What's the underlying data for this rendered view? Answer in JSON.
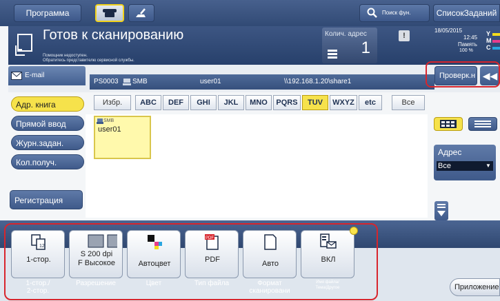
{
  "topbar": {
    "program_label": "Программа",
    "search_label": "Поиск фун.",
    "jobs_label": "СписокЗаданий"
  },
  "status": {
    "title": "Готов к сканированию",
    "sub_line1": "Помощник недоступен.",
    "sub_line2": "Обратитесь представителю сервисной службы.",
    "counter_label": "Колич. адрес",
    "counter_value": "1",
    "warn_symbol": "!",
    "date": "18/05/2015",
    "time": "12:45",
    "memory_label": "Память",
    "memory_pct": "100 %",
    "toners": [
      {
        "letter": "Y",
        "color": "#f5dd1c"
      },
      {
        "letter": "M",
        "color": "#e83c8c"
      },
      {
        "letter": "C",
        "color": "#2aa6e0"
      }
    ]
  },
  "destination": {
    "tab_label": "E-mail",
    "code": "PS0003",
    "type": "SMB",
    "user": "user01",
    "path": "\\\\192.168.1.20\\share1",
    "check_label": "Проверк.н",
    "collapse_symbol": "◀◀"
  },
  "side_nav": {
    "items": [
      {
        "label": "Адр. книга"
      },
      {
        "label": "Прямой ввод"
      },
      {
        "label": "Журн.задан."
      },
      {
        "label": "Кол.получ."
      }
    ],
    "register_label": "Регистрация"
  },
  "index": {
    "favorites": "Избр.",
    "letters": [
      "ABC",
      "DEF",
      "GHI",
      "JKL",
      "MNO",
      "PQRS",
      "TUV",
      "WXYZ",
      "etc"
    ],
    "selected": "TUV",
    "all": "Все"
  },
  "address_list": [
    {
      "type": "SMB",
      "name": "user01"
    }
  ],
  "address_filter": {
    "label": "Адрес",
    "value": "Все"
  },
  "function_keys": [
    {
      "value": "1-стор.",
      "label": "1-стор./\n2-стор.",
      "icon": "duplex-icon"
    },
    {
      "value": "S 200 dpi\nF Высокое",
      "label": "Разрешение",
      "icon": "resolution-icon"
    },
    {
      "value": "Автоцвет",
      "label": "Цвет",
      "icon": "color-icon"
    },
    {
      "value": "PDF",
      "label": "Тип файла",
      "icon": "pdf-icon"
    },
    {
      "value": "Авто",
      "label": "Формат\nсканировани",
      "icon": "page-size-icon"
    },
    {
      "value": "ВКЛ",
      "label": "Имя файла/\nТема/Другое",
      "icon": "email-settings-icon"
    }
  ],
  "app_label": "Приложение"
}
